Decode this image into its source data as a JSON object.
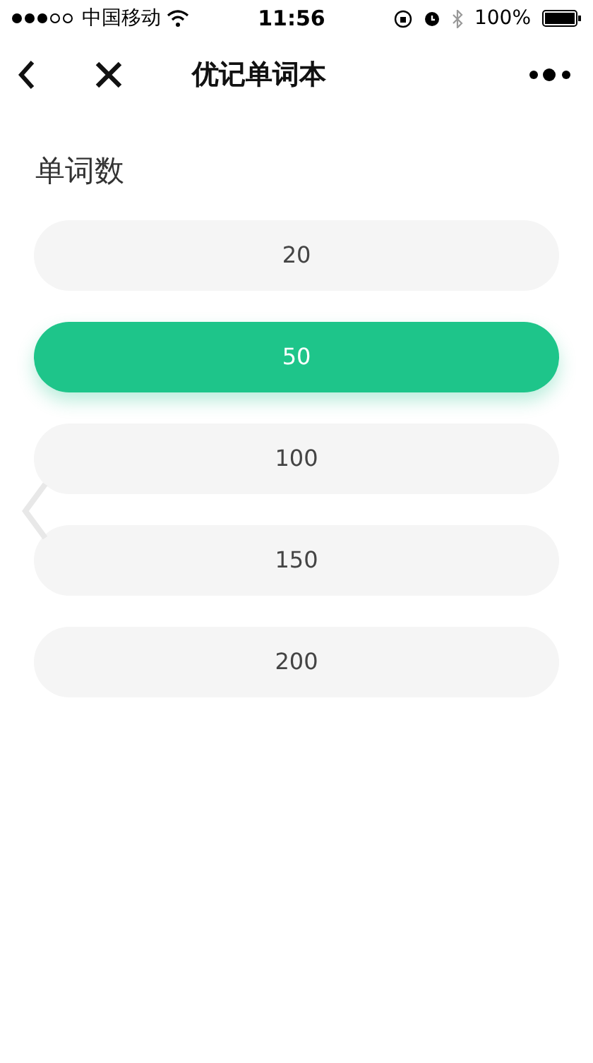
{
  "status_bar": {
    "carrier": "中国移动",
    "time": "11:56",
    "battery": "100%"
  },
  "nav_bar": {
    "title": "优记单词本"
  },
  "section": {
    "title": "单词数"
  },
  "options": [
    {
      "label": "20",
      "selected": false
    },
    {
      "label": "50",
      "selected": true
    },
    {
      "label": "100",
      "selected": false
    },
    {
      "label": "150",
      "selected": false
    },
    {
      "label": "200",
      "selected": false
    }
  ]
}
